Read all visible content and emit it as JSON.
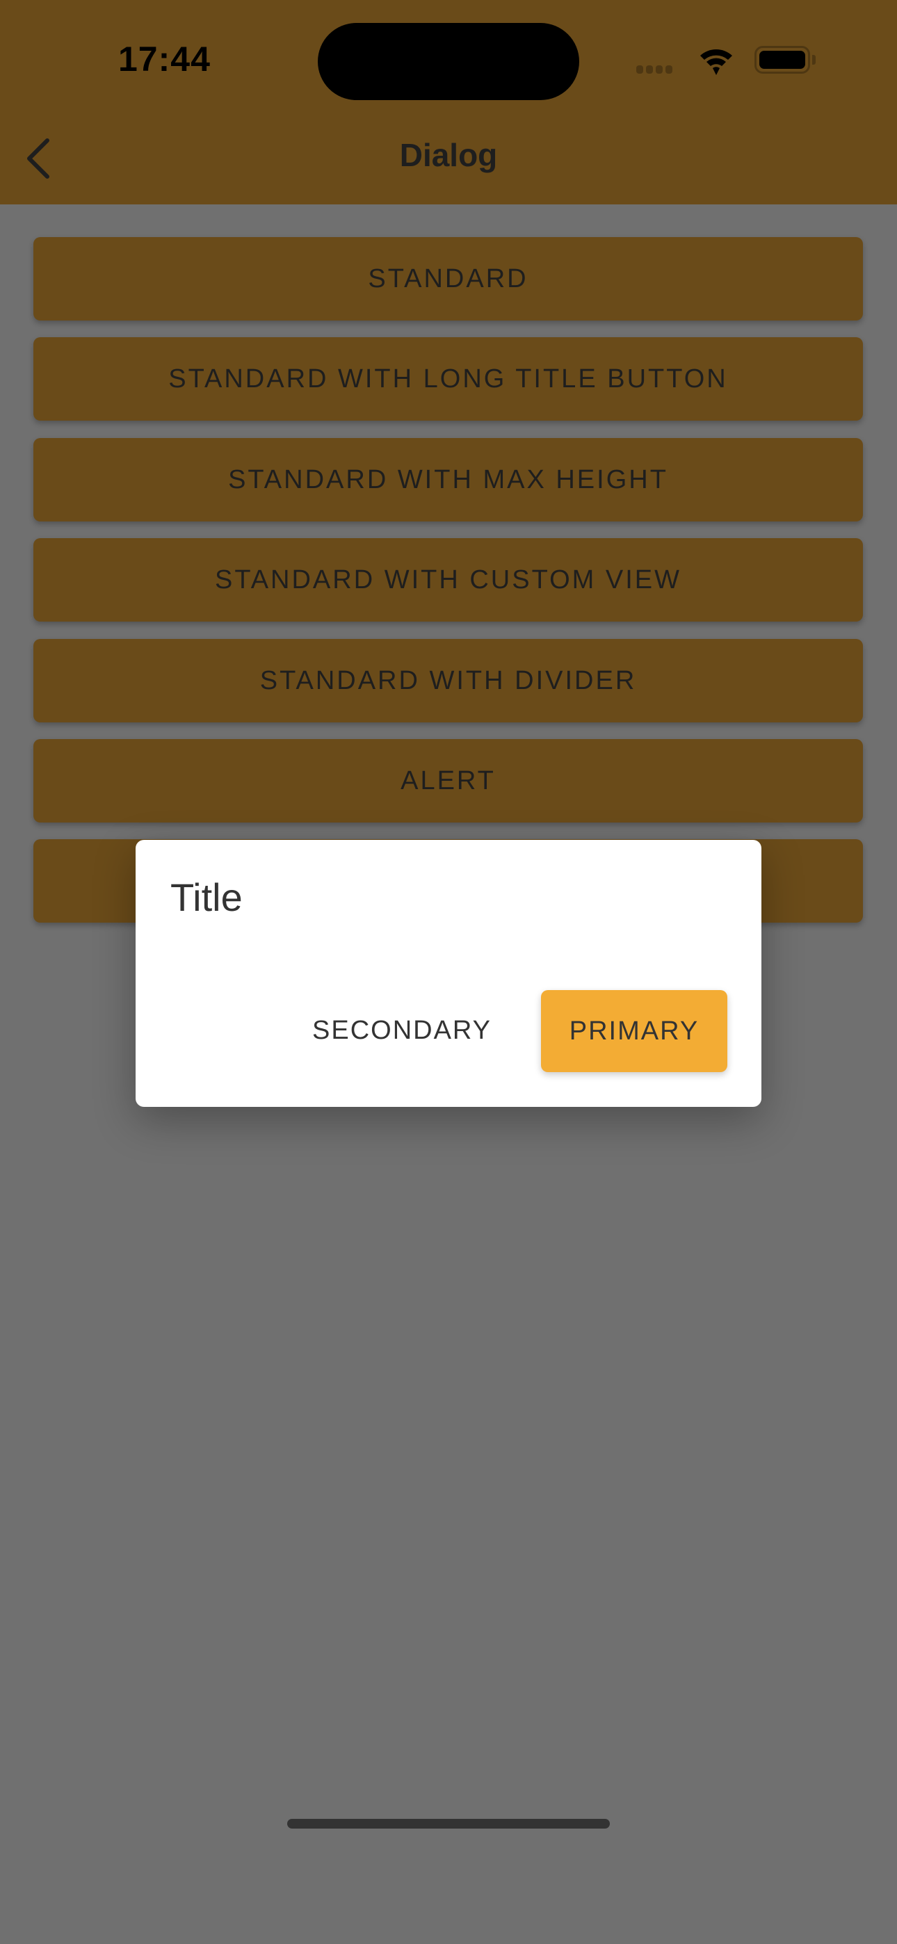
{
  "status_bar": {
    "time": "17:44"
  },
  "nav": {
    "title": "Dialog",
    "back_icon": "chevron-left-icon"
  },
  "buttons": [
    {
      "label": "STANDARD"
    },
    {
      "label": "STANDARD WITH LONG TITLE BUTTON"
    },
    {
      "label": "STANDARD WITH MAX HEIGHT"
    },
    {
      "label": "STANDARD WITH CUSTOM VIEW"
    },
    {
      "label": "STANDARD WITH DIVIDER"
    },
    {
      "label": "ALERT"
    },
    {
      "label": ""
    }
  ],
  "dialog": {
    "title": "Title",
    "secondary_label": "SECONDARY",
    "primary_label": "PRIMARY"
  },
  "colors": {
    "accent": "#F3AC34",
    "scrim": "#707070",
    "dimmed_accent": "#6A4B19"
  }
}
